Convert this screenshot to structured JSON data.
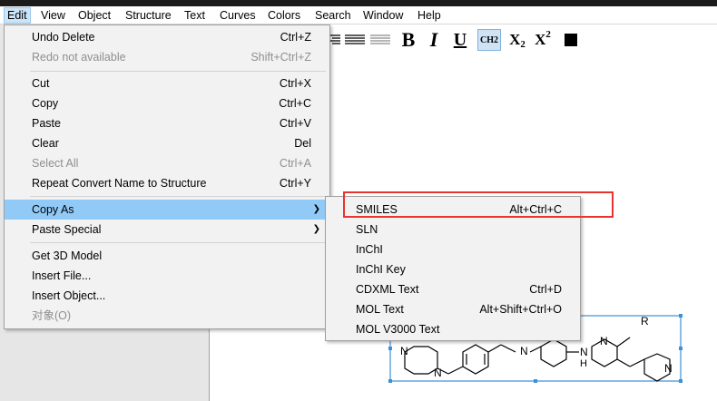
{
  "menubar": {
    "items": [
      "Edit",
      "View",
      "Object",
      "Structure",
      "Text",
      "Curves",
      "Colors",
      "Search",
      "Window",
      "Help"
    ]
  },
  "edit_menu": {
    "items": [
      {
        "label": "Undo Delete",
        "shortcut": "Ctrl+Z",
        "disabled": false
      },
      {
        "label": "Redo not available",
        "shortcut": "Shift+Ctrl+Z",
        "disabled": true
      },
      {
        "label": "Cut",
        "shortcut": "Ctrl+X",
        "disabled": false
      },
      {
        "label": "Copy",
        "shortcut": "Ctrl+C",
        "disabled": false
      },
      {
        "label": "Paste",
        "shortcut": "Ctrl+V",
        "disabled": false
      },
      {
        "label": "Clear",
        "shortcut": "Del",
        "disabled": false
      },
      {
        "label": "Select All",
        "shortcut": "Ctrl+A",
        "disabled": true
      },
      {
        "label": "Repeat Convert Name to Structure",
        "shortcut": "Ctrl+Y",
        "disabled": false
      },
      {
        "label": "Copy As",
        "shortcut": "",
        "disabled": false,
        "submenu": true,
        "highlighted": true
      },
      {
        "label": "Paste Special",
        "shortcut": "",
        "disabled": false,
        "submenu": true
      },
      {
        "label": "Get 3D Model",
        "shortcut": "",
        "disabled": false
      },
      {
        "label": "Insert File...",
        "shortcut": "",
        "disabled": false
      },
      {
        "label": "Insert Object...",
        "shortcut": "",
        "disabled": false
      },
      {
        "label": "对象(O)",
        "shortcut": "",
        "disabled": true
      }
    ]
  },
  "copy_as_menu": {
    "items": [
      {
        "label": "SMILES",
        "shortcut": "Alt+Ctrl+C"
      },
      {
        "label": "SLN",
        "shortcut": ""
      },
      {
        "label": "InChI",
        "shortcut": ""
      },
      {
        "label": "InChI Key",
        "shortcut": ""
      },
      {
        "label": "CDXML Text",
        "shortcut": "Ctrl+D"
      },
      {
        "label": "MOL Text",
        "shortcut": "Alt+Shift+Ctrl+O"
      },
      {
        "label": "MOL V3000 Text",
        "shortcut": ""
      }
    ]
  },
  "toolbar": {
    "bold": "B",
    "italic": "I",
    "underline": "U",
    "chemical": "CH2",
    "subscript": "X2",
    "superscript": "X2"
  },
  "molecule": {
    "labels": [
      "N",
      "N",
      "N",
      "N",
      "N",
      "N",
      "R"
    ]
  },
  "colors": {
    "highlight": "#91c9f7",
    "callout": "#e8332f",
    "selection": "#3c8fd9"
  }
}
